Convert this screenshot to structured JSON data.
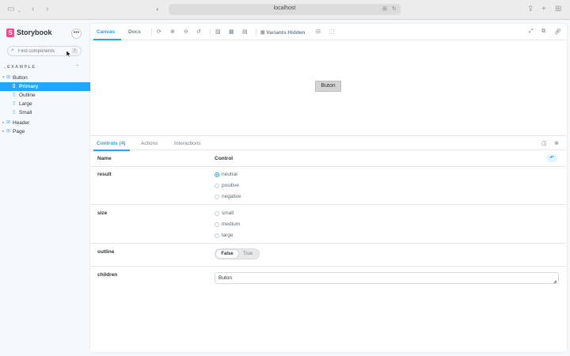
{
  "browser": {
    "url": "localhost"
  },
  "sidebar": {
    "brand": "Storybook",
    "brand_badge": "S",
    "search_placeholder": "Find components",
    "search_shortcut": "/",
    "section_title": "EXAMPLE",
    "tree": [
      {
        "label": "Button",
        "level": 0,
        "kind": "component",
        "expanded": true
      },
      {
        "label": "Primary",
        "level": 1,
        "kind": "story",
        "selected": true
      },
      {
        "label": "Outline",
        "level": 1,
        "kind": "story"
      },
      {
        "label": "Large",
        "level": 1,
        "kind": "story"
      },
      {
        "label": "Small",
        "level": 1,
        "kind": "story"
      },
      {
        "label": "Header",
        "level": 0,
        "kind": "component",
        "expanded": false
      },
      {
        "label": "Page",
        "level": 0,
        "kind": "component",
        "expanded": false
      }
    ]
  },
  "toolbar": {
    "tabs": [
      "Canvas",
      "Docs"
    ],
    "active_tab": "Canvas",
    "variants_label": "Variants Hidden"
  },
  "canvas": {
    "button_label": "Buton"
  },
  "addons": {
    "tabs": [
      "Controls (4)",
      "Actions",
      "Interactions"
    ],
    "active_tab": "Controls (4)"
  },
  "controls": {
    "header_name": "Name",
    "header_control": "Control",
    "result": {
      "name": "result",
      "options": [
        "neutral",
        "positive",
        "negative"
      ],
      "selected": "neutral"
    },
    "size": {
      "name": "size",
      "options": [
        "small",
        "medium",
        "large"
      ],
      "selected": null
    },
    "outline": {
      "name": "outline",
      "options": [
        "False",
        "True"
      ],
      "selected": "False"
    },
    "children": {
      "name": "children",
      "value": "Buton"
    }
  },
  "colors": {
    "accent": "#1ea7fd",
    "brand": "#ff4785",
    "selected_bg": "#1ea7fd"
  }
}
